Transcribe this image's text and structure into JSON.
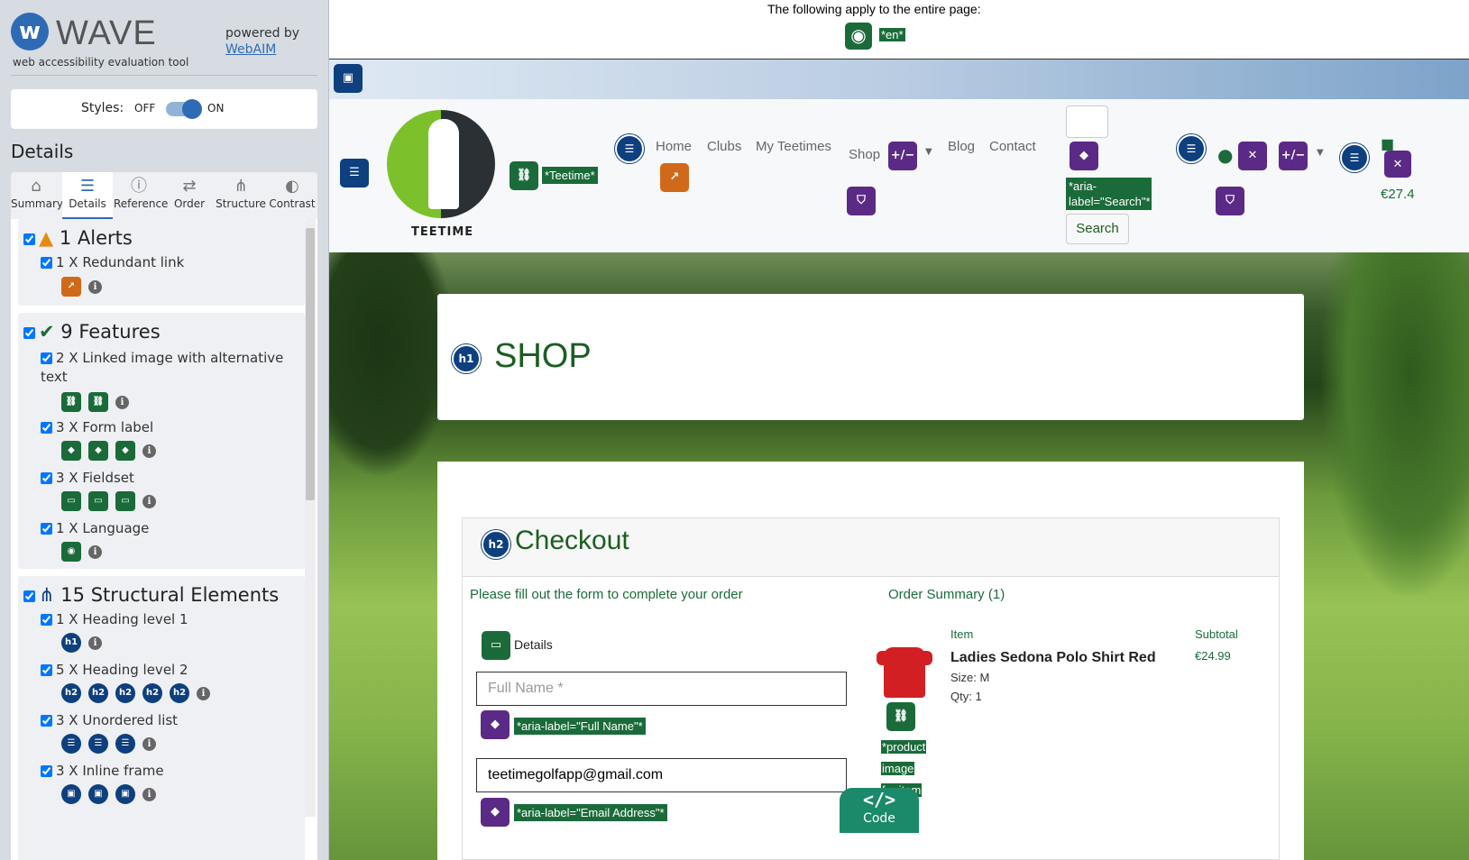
{
  "wave": {
    "brand": "WAVE",
    "tagline": "web accessibility evaluation tool",
    "powered_by": "powered by",
    "webaim": "WebAIM",
    "styles_label": "Styles:",
    "styles_off": "OFF",
    "styles_on": "ON",
    "styles_state": "on",
    "details_heading": "Details",
    "tabs": [
      {
        "label": "Summary",
        "icon": "home-icon"
      },
      {
        "label": "Details",
        "icon": "list-icon",
        "active": true
      },
      {
        "label": "Reference",
        "icon": "info-icon"
      },
      {
        "label": "Order",
        "icon": "order-icon"
      },
      {
        "label": "Structure",
        "icon": "structure-icon"
      },
      {
        "label": "Contrast",
        "icon": "contrast-icon"
      }
    ],
    "alerts": {
      "title": "1 Alerts",
      "items": [
        {
          "label": "1 X Redundant link"
        }
      ]
    },
    "features": {
      "title": "9 Features",
      "items": [
        {
          "label": "2 X Linked image with alternative text"
        },
        {
          "label": "3 X Form label"
        },
        {
          "label": "3 X Fieldset"
        },
        {
          "label": "1 X Language"
        }
      ]
    },
    "structure": {
      "title": "15 Structural Elements",
      "items": [
        {
          "label": "1 X Heading level 1",
          "badges": [
            "h1"
          ]
        },
        {
          "label": "5 X Heading level 2",
          "badges": [
            "h2",
            "h2",
            "h2",
            "h2",
            "h2"
          ]
        },
        {
          "label": "3 X Unordered list"
        },
        {
          "label": "3 X Inline frame"
        }
      ]
    }
  },
  "page": {
    "applies_text": "The following apply to the entire page:",
    "lang_tag": "*en*",
    "logo_text": "TEETIME",
    "logo_alt_tag": "*Teetime*",
    "nav": [
      "Home",
      "Clubs",
      "My Teetimes",
      "Shop",
      "Blog",
      "Contact"
    ],
    "search_aria": "*aria-label=\"Search\"*",
    "search_button": "Search",
    "cart_price": "€27.4",
    "shop_heading": "SHOP",
    "checkout_heading": "Checkout",
    "form_intro": "Please fill out the form to complete your order",
    "order_summary": "Order Summary (1)",
    "fieldset_legend": "Details",
    "full_name_placeholder": "Full Name *",
    "full_name_aria": "*aria-label=\"Full Name\"*",
    "email_value": "teetimegolfapp@gmail.com",
    "email_aria": "*aria-label=\"Email Address\"*",
    "product_alt_words": [
      "*product",
      "image",
      "for item"
    ],
    "table": {
      "item_header": "Item",
      "subtotal_header": "Subtotal",
      "item_name": "Ladies Sedona Polo Shirt Red",
      "size": "Size: M",
      "qty": "Qty: 1",
      "subtotal": "€24.99"
    },
    "code_button": "Code",
    "code_glyph": "</>"
  }
}
